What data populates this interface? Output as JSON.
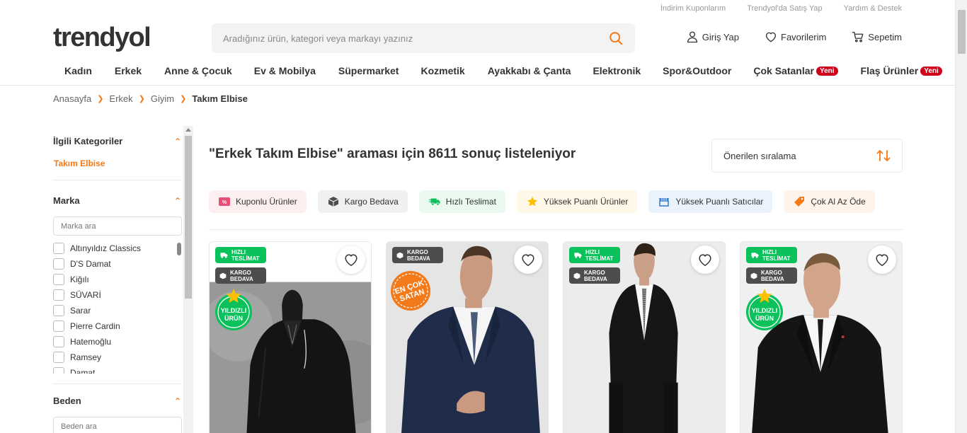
{
  "top_links": [
    "İndirim Kuponlarım",
    "Trendyol'da Satış Yap",
    "Yardım & Destek"
  ],
  "logo": "trendyol",
  "search": {
    "placeholder": "Aradığınız ürün, kategori veya markayı yazınız"
  },
  "header_actions": {
    "login": "Giriş Yap",
    "favorites": "Favorilerim",
    "cart": "Sepetim"
  },
  "nav": {
    "items": [
      "Kadın",
      "Erkek",
      "Anne & Çocuk",
      "Ev & Mobilya",
      "Süpermarket",
      "Kozmetik",
      "Ayakkabı & Çanta",
      "Elektronik",
      "Spor&Outdoor",
      "Çok Satanlar",
      "Flaş Ürünler"
    ],
    "badge": "Yeni"
  },
  "breadcrumb": [
    "Anasayfa",
    "Erkek",
    "Giyim",
    "Takım Elbise"
  ],
  "sidebar": {
    "related_title": "İlgili Kategoriler",
    "related_active": "Takım Elbise",
    "brand_title": "Marka",
    "brand_search_placeholder": "Marka ara",
    "brands": [
      "Altınyıldız Classics",
      "D'S Damat",
      "Kiğılı",
      "SÜVARİ",
      "Sarar",
      "Pierre Cardin",
      "Hatemoğlu",
      "Ramsey",
      "Damat"
    ],
    "size_title": "Beden",
    "size_search_placeholder": "Beden ara"
  },
  "results": {
    "title": "\"Erkek Takım Elbise\" araması için 8611 sonuç listeleniyor",
    "sort": "Önerilen sıralama"
  },
  "chips": [
    {
      "label": "Kuponlu Ürünler",
      "icon": "coupon-icon",
      "bg": "#fdeef0",
      "color": "#e94e77"
    },
    {
      "label": "Kargo Bedava",
      "icon": "box-icon",
      "bg": "#f0f0f0",
      "color": "#4d4d4d"
    },
    {
      "label": "Hızlı Teslimat",
      "icon": "truck-icon",
      "bg": "#eafaf1",
      "color": "#0bc15c"
    },
    {
      "label": "Yüksek Puanlı Ürünler",
      "icon": "star-icon",
      "bg": "#fff8e8",
      "color": "#ffc000"
    },
    {
      "label": "Yüksek Puanlı Satıcılar",
      "icon": "store-icon",
      "bg": "#eaf3fc",
      "color": "#3d7fd1"
    },
    {
      "label": "Çok Al Az Öde",
      "icon": "tag-icon",
      "bg": "#fff3ea",
      "color": "#f27a1a"
    }
  ],
  "badges": {
    "fast_delivery": [
      "HIZLI",
      "TESLİMAT"
    ],
    "free_shipping": [
      "KARGO",
      "BEDAVA"
    ],
    "starred_product": [
      "YILDIZLI",
      "ÜRÜN"
    ],
    "best_seller": [
      "EN ÇOK",
      "SATAN"
    ]
  },
  "colors": {
    "brand": "#f27a1a",
    "new_badge": "#d0021b",
    "fast_delivery": "#0bc15c",
    "free_shipping": "#4d4d4d"
  }
}
